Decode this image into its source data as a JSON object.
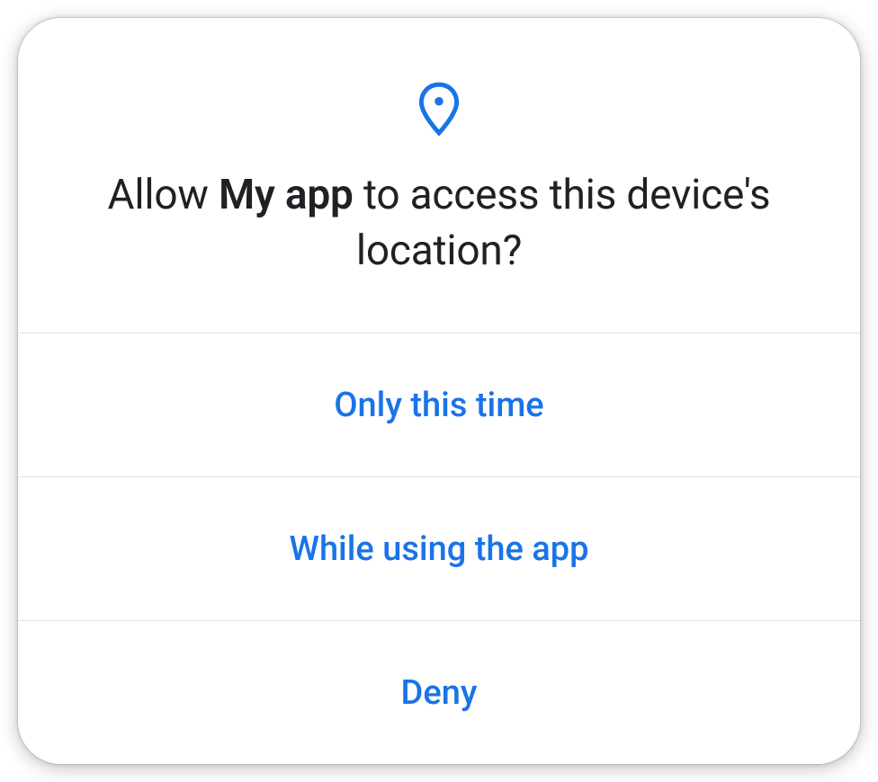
{
  "dialog": {
    "icon_name": "location-pin-icon",
    "title_prefix": "Allow ",
    "app_name": "My app",
    "title_suffix": " to access this device's location?",
    "options": {
      "only_this_time": "Only this time",
      "while_using_app": "While using the app",
      "deny": "Deny"
    },
    "colors": {
      "accent": "#1a73e8",
      "text": "#202124",
      "divider": "#e3e3e3"
    }
  }
}
